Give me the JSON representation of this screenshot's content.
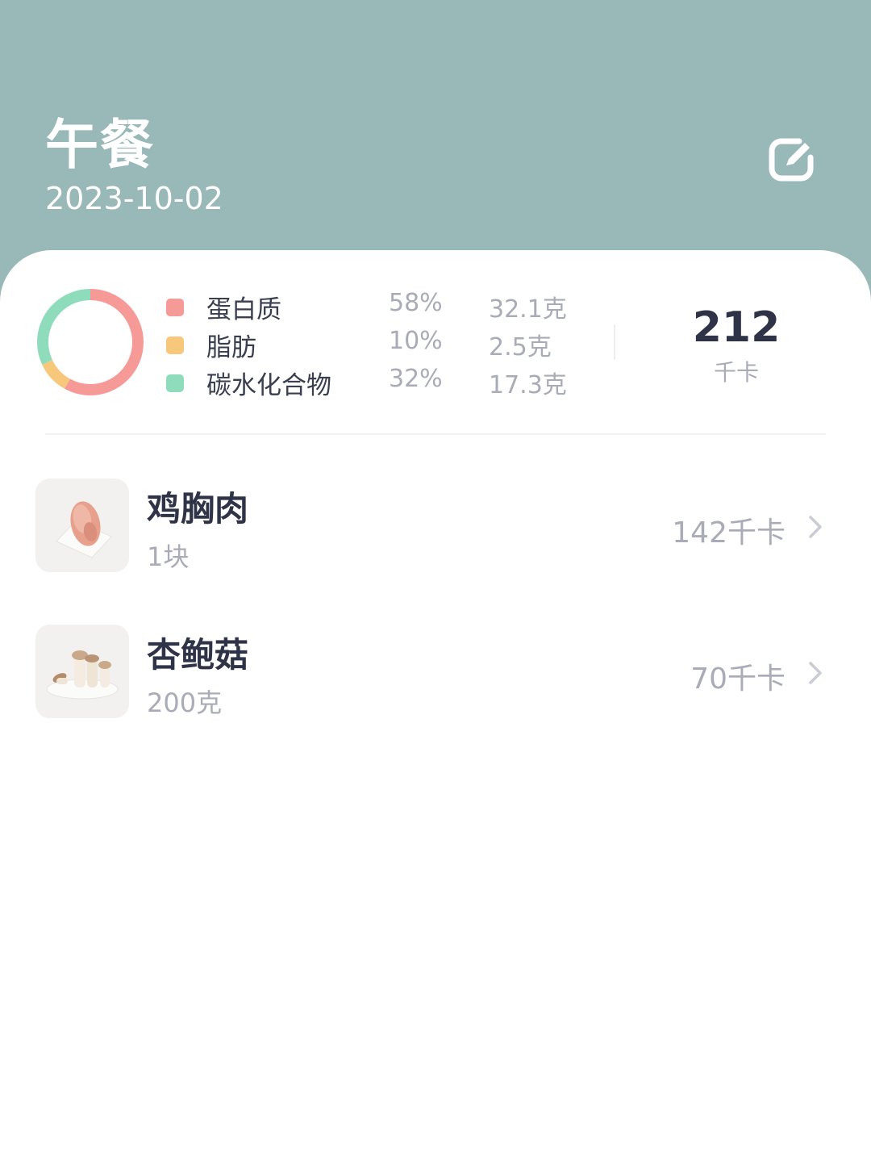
{
  "header": {
    "title": "午餐",
    "date": "2023-10-02",
    "edit_icon": "edit-icon"
  },
  "summary": {
    "chart_data": {
      "type": "pie",
      "donut": true,
      "categories": [
        "蛋白质",
        "脂肪",
        "碳水化合物"
      ],
      "values": [
        58,
        10,
        32
      ],
      "colors": [
        "#f69a97",
        "#f7c77c",
        "#8fdcbd"
      ]
    },
    "macros": [
      {
        "name": "蛋白质",
        "percent": "58%",
        "grams": "32.1克",
        "color": "#f69a97"
      },
      {
        "name": "脂肪",
        "percent": "10%",
        "grams": "2.5克",
        "color": "#f7c77c"
      },
      {
        "name": "碳水化合物",
        "percent": "32%",
        "grams": "17.3克",
        "color": "#8fdcbd"
      }
    ],
    "total_kcal": "212",
    "kcal_unit": "千卡"
  },
  "foods": [
    {
      "name": "鸡胸肉",
      "amount": "1块",
      "kcal": "142千卡",
      "image": "chicken-breast-photo"
    },
    {
      "name": "杏鲍菇",
      "amount": "200克",
      "kcal": "70千卡",
      "image": "king-oyster-mushroom-photo"
    }
  ],
  "colors": {
    "header_bg": "#99b8b8",
    "primary_text": "#2e3347",
    "secondary_text": "#a9acb6"
  }
}
